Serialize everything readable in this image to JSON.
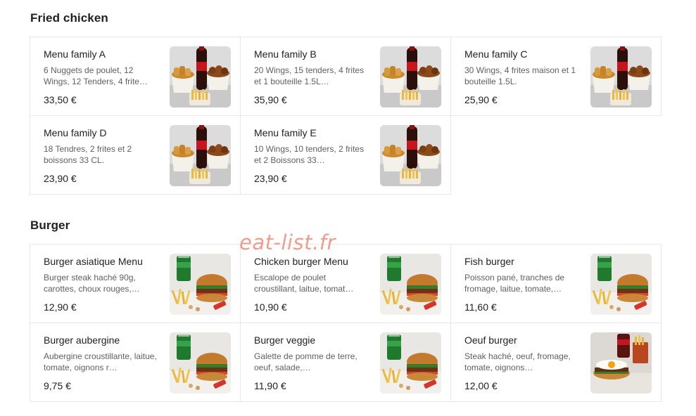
{
  "sections": [
    {
      "title": "Fried chicken",
      "items": [
        {
          "name": "Menu family A",
          "desc": "6 Nuggets de poulet, 12 Wings, 12 Tenders, 4 frite…",
          "price": "33,50 €",
          "photo": "chicken-bucket-photo"
        },
        {
          "name": "Menu family B",
          "desc": "20 Wings, 15 tenders, 4 frites et 1 bouteille 1.5L…",
          "price": "35,90 €",
          "photo": "chicken-bucket-photo"
        },
        {
          "name": "Menu family C",
          "desc": "30 Wings, 4 frites maison et 1 bouteille 1.5L.",
          "price": "25,90 €",
          "photo": "chicken-bucket-photo"
        },
        {
          "name": "Menu family D",
          "desc": "18 Tendres, 2 frites et 2 boissons 33 CL.",
          "price": "23,90 €",
          "photo": "chicken-bucket-photo"
        },
        {
          "name": "Menu family E",
          "desc": "10 Wings, 10 tenders, 2 frites et 2 Boissons 33…",
          "price": "23,90 €",
          "photo": "chicken-bucket-photo"
        }
      ]
    },
    {
      "title": "Burger",
      "items": [
        {
          "name": "Burger asiatique Menu",
          "desc": "Burger steak haché 90g, carottes, choux rouges,…",
          "price": "12,90 €",
          "photo": "burger-photo"
        },
        {
          "name": "Chicken burger Menu",
          "desc": "Escalope de poulet croustillant, laitue, tomat…",
          "price": "10,90 €",
          "photo": "burger-photo"
        },
        {
          "name": "Fish burger",
          "desc": "Poisson pané, tranches de fromage, laitue, tomate,…",
          "price": "11,60 €",
          "photo": "burger-photo"
        },
        {
          "name": "Burger aubergine",
          "desc": "Aubergine croustillante, laitue, tomate, oignons r…",
          "price": "9,75 €",
          "photo": "burger-photo"
        },
        {
          "name": "Burger veggie",
          "desc": "Galette de pomme de terre, oeuf, salade,…",
          "price": "11,90 €",
          "photo": "burger-photo"
        },
        {
          "name": "Oeuf burger",
          "desc": "Steak haché, oeuf, fromage, tomate, oignons…",
          "price": "12,00 €",
          "photo": "egg-burger-photo"
        }
      ]
    }
  ],
  "watermark": "eat-list.fr"
}
